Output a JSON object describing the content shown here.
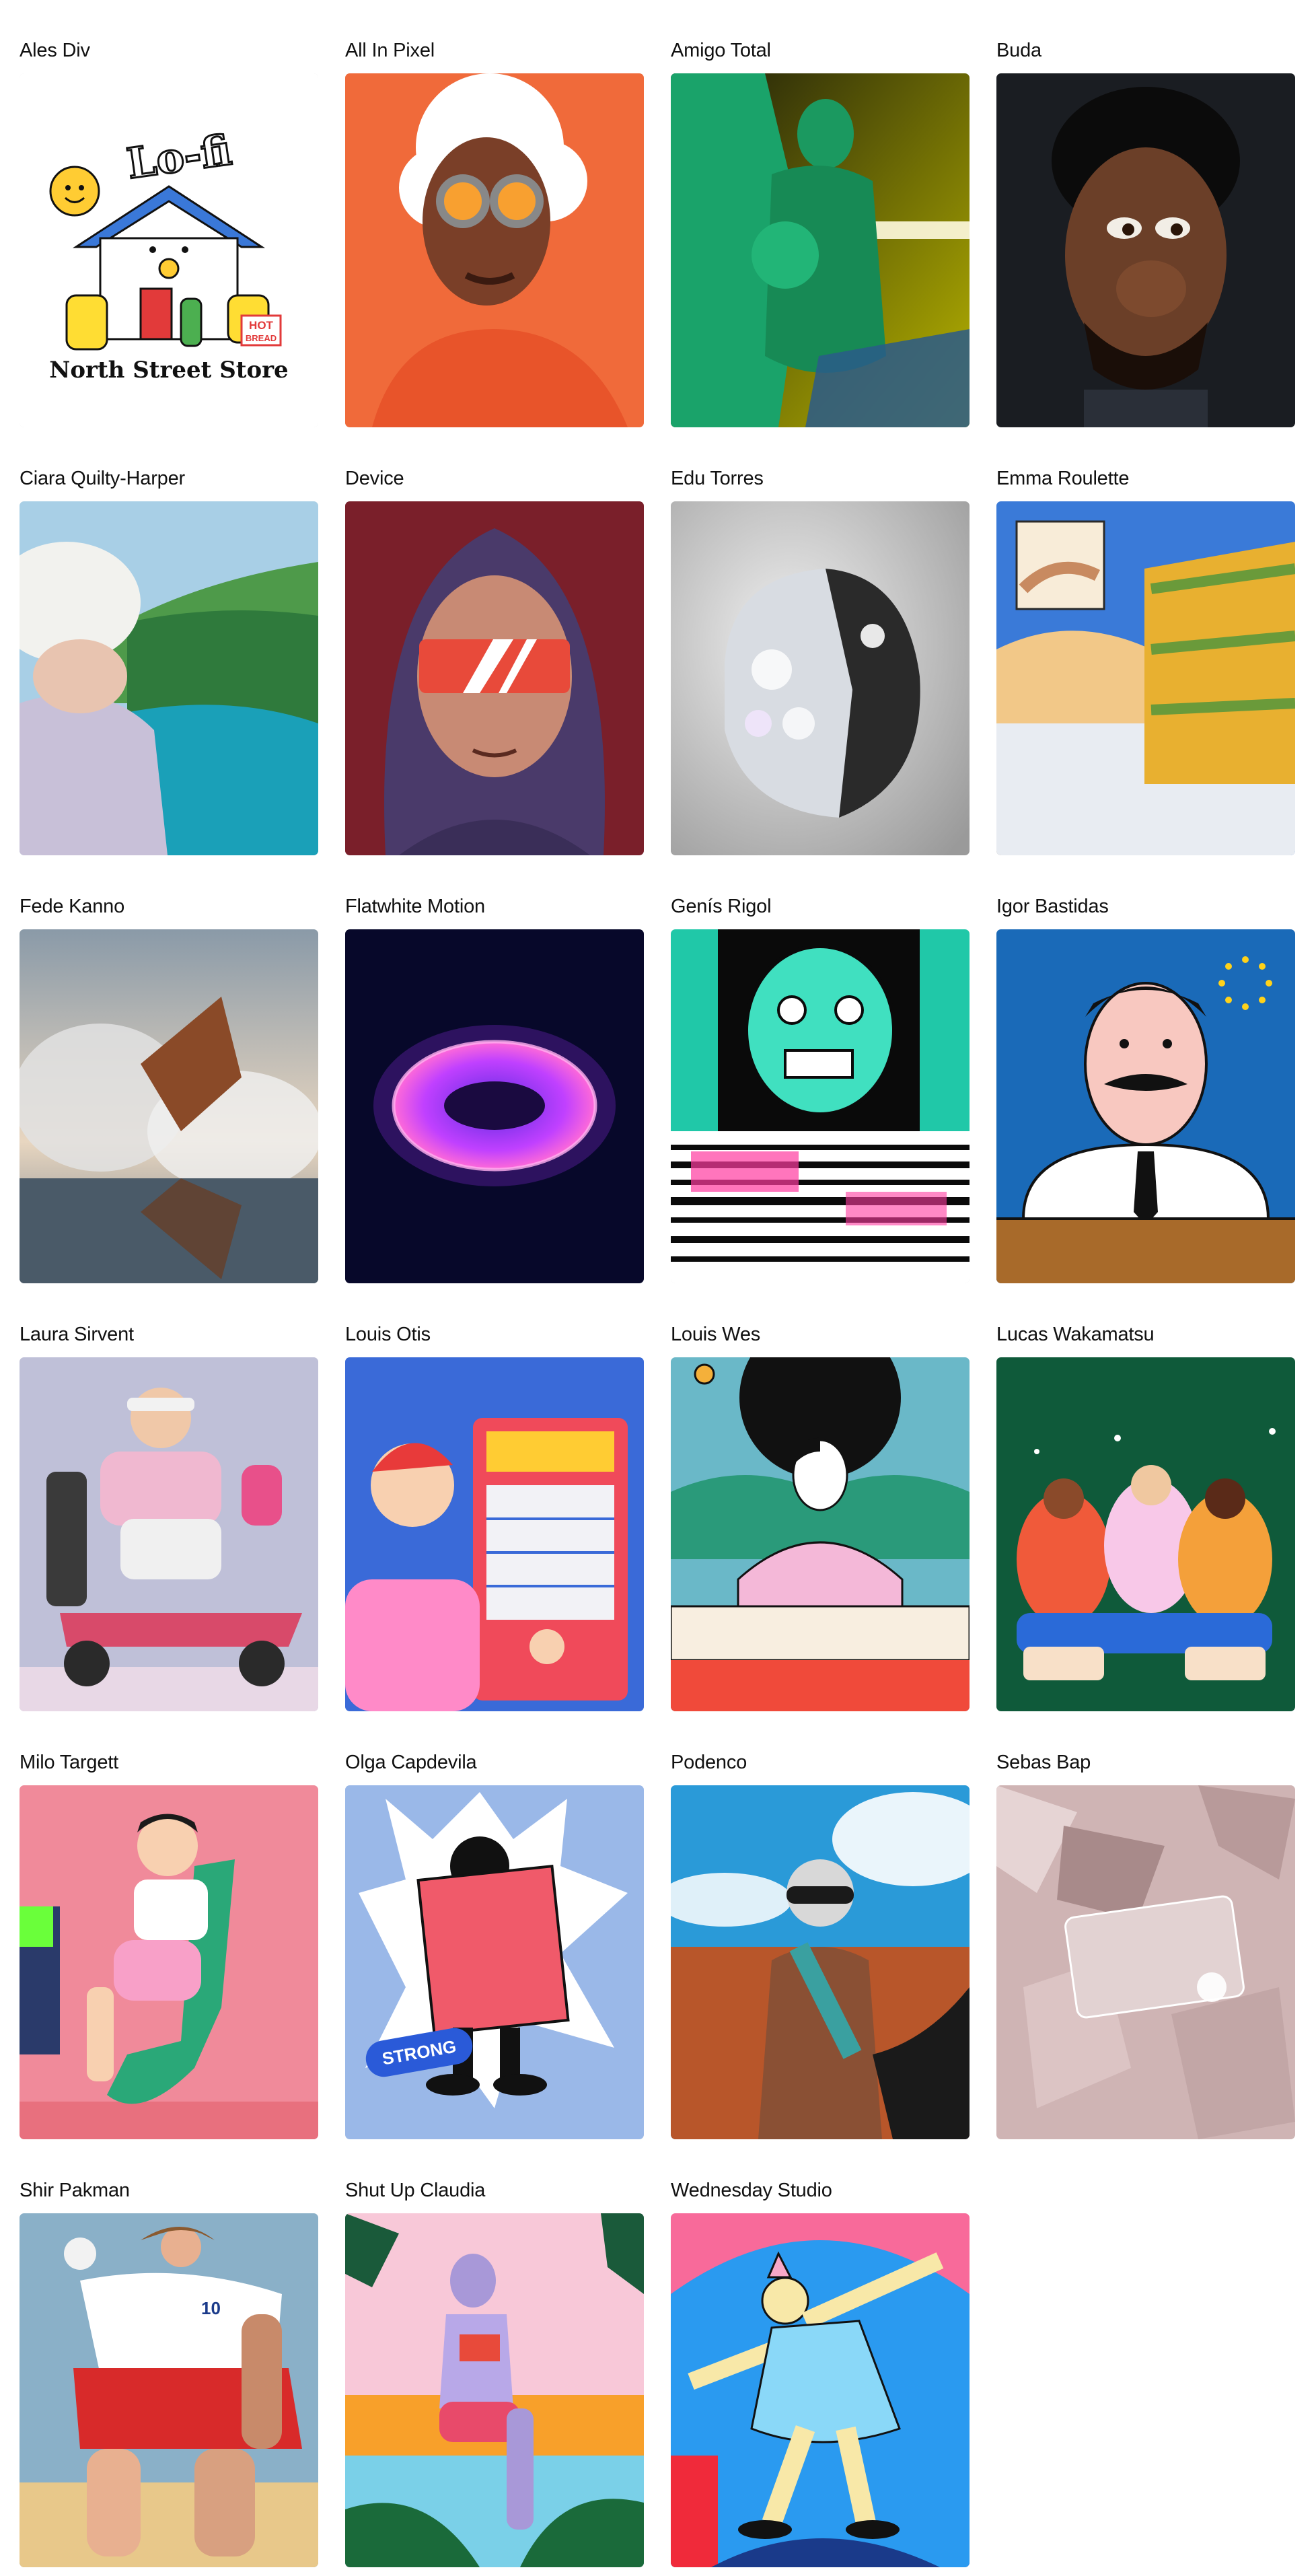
{
  "artists": [
    {
      "name": "Ales Div",
      "artwork": "lo-fi-house-illustration",
      "logo_text": [
        "Lo-fi",
        "HOT",
        "BREAD",
        "North Street Store"
      ]
    },
    {
      "name": "All In Pixel",
      "artwork": "pixel-portrait-orange"
    },
    {
      "name": "Amigo Total",
      "artwork": "green-fashion-render"
    },
    {
      "name": "Buda",
      "artwork": "3d-character-portrait"
    },
    {
      "name": "Ciara Quilty-Harper",
      "artwork": "painterly-landscape"
    },
    {
      "name": "Device",
      "artwork": "hooded-figure-visor"
    },
    {
      "name": "Edu Torres",
      "artwork": "crystal-rock-render"
    },
    {
      "name": "Emma Roulette",
      "artwork": "palace-gardens-illustration"
    },
    {
      "name": "Fede Kanno",
      "artwork": "surreal-smoke-sculpture"
    },
    {
      "name": "Flatwhite Motion",
      "artwork": "glowing-torus"
    },
    {
      "name": "Genís Rigol",
      "artwork": "glitch-cartoon-face"
    },
    {
      "name": "Igor Bastidas",
      "artwork": "mustache-politician"
    },
    {
      "name": "Laura Sirvent",
      "artwork": "scooter-grandpa-3d"
    },
    {
      "name": "Louis Otis",
      "artwork": "vending-machine-kid"
    },
    {
      "name": "Louis Wes",
      "artwork": "writer-at-desk"
    },
    {
      "name": "Lucas Wakamatsu",
      "artwork": "crowd-celebration"
    },
    {
      "name": "Milo Targett",
      "artwork": "dentist-chair-character"
    },
    {
      "name": "Olga Capdevila",
      "artwork": "newspaper-reader",
      "logo_text": [
        "STRONG"
      ]
    },
    {
      "name": "Podenco",
      "artwork": "desert-figure-photo"
    },
    {
      "name": "Sebas Bap",
      "artwork": "crumpled-card"
    },
    {
      "name": "Shir Pakman",
      "artwork": "volleyball-player",
      "logo_text": [
        "10"
      ]
    },
    {
      "name": "Shut Up Claudia",
      "artwork": "poolside-woman"
    },
    {
      "name": "Wednesday Studio",
      "artwork": "dancing-figure"
    }
  ]
}
